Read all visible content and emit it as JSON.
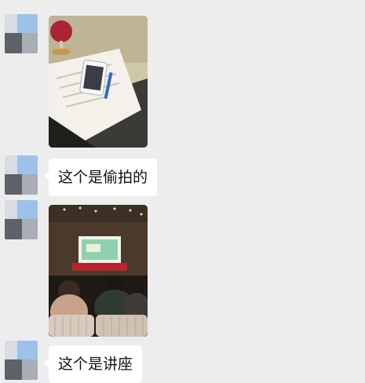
{
  "messages": [
    {
      "type": "image",
      "description": "photo-desk-phone-wine"
    },
    {
      "type": "text",
      "text": "这个是偷拍的"
    },
    {
      "type": "image",
      "description": "photo-lecture-hall"
    },
    {
      "type": "text",
      "text": "这个是讲座"
    }
  ],
  "colors": {
    "background": "#ededed",
    "bubble": "#ffffff",
    "avatar_blue": "#8fb8e6",
    "avatar_gray": "#5a5f66"
  }
}
